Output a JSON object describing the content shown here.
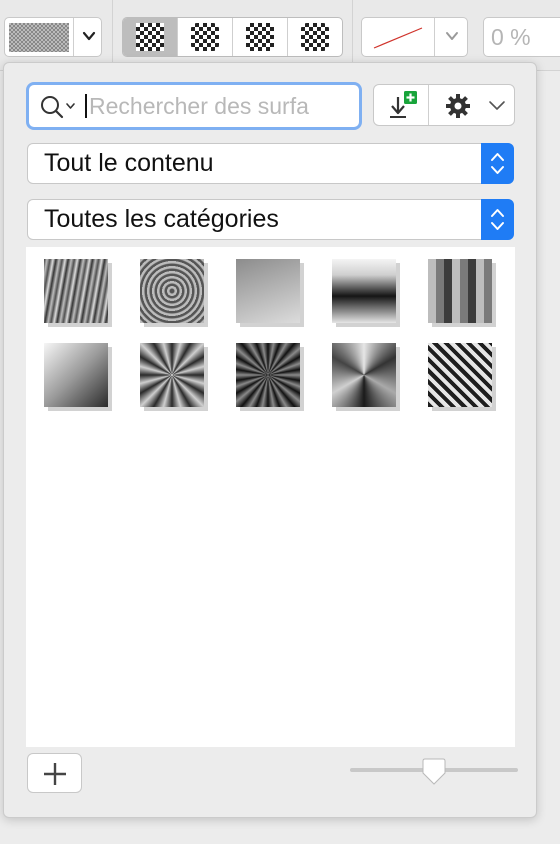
{
  "toolbar": {
    "surface_picker": {
      "icon": "checker-swatch",
      "menu_icon": "chevron-down-icon"
    },
    "surface_modes": [
      {
        "id": "mode-1",
        "active": true
      },
      {
        "id": "mode-2",
        "active": false
      },
      {
        "id": "mode-3",
        "active": false
      },
      {
        "id": "mode-4",
        "active": false
      }
    ],
    "line_picker": {
      "line_color": "#d0342c",
      "menu_icon": "chevron-down-icon"
    },
    "opacity_value": "0 %"
  },
  "popover": {
    "search": {
      "value": "",
      "placeholder": "Rechercher des surfa",
      "icon": "search-icon"
    },
    "actions": {
      "import_icon": "import-icon",
      "settings_icon": "gear-icon"
    },
    "content_filter": {
      "selected": "Tout le contenu"
    },
    "category_filter": {
      "selected": "Toutes les catégories"
    },
    "surfaces": [
      {
        "name": "diagonal-streaks"
      },
      {
        "name": "concentric-rings"
      },
      {
        "name": "soft-gradient"
      },
      {
        "name": "horizontal-band"
      },
      {
        "name": "vertical-stripes"
      },
      {
        "name": "diagonal-fade"
      },
      {
        "name": "radial-burst-light"
      },
      {
        "name": "radial-burst-dark"
      },
      {
        "name": "conical-sweep"
      },
      {
        "name": "diagonal-hatch"
      }
    ],
    "add_label": "+",
    "size_slider": {
      "value": 0.5
    }
  },
  "colors": {
    "accent": "#1f7cf5",
    "focus_ring": "#7fb0f2",
    "import_badge": "#18a43a"
  }
}
